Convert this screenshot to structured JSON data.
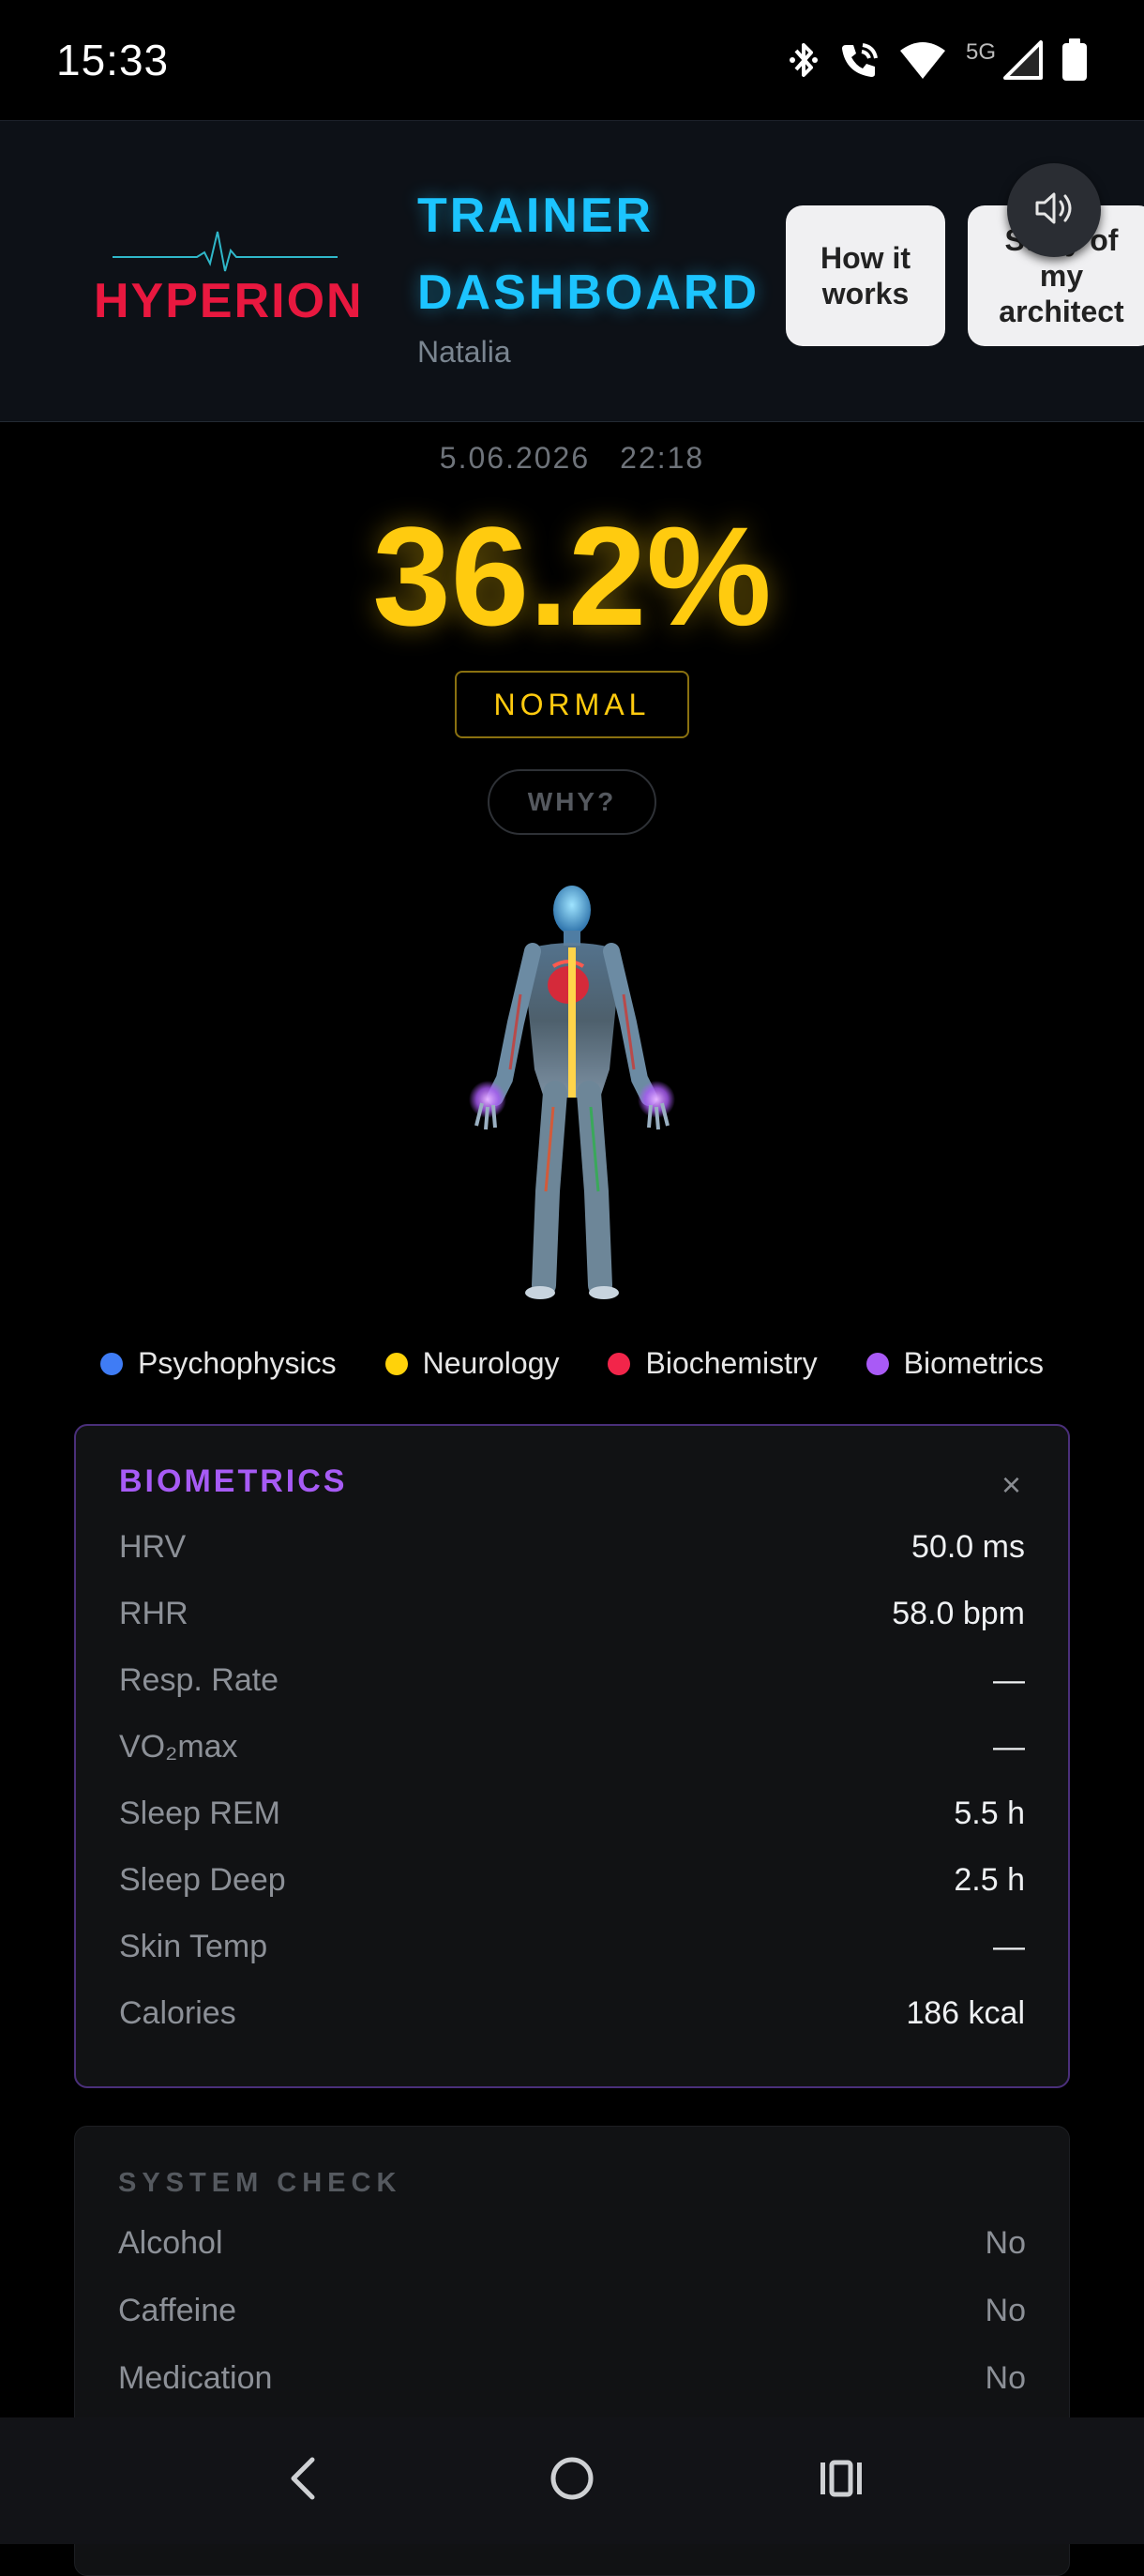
{
  "status_bar": {
    "time": "15:33",
    "network_label": "5G",
    "icons": [
      "bluetooth-icon",
      "wifi-calling-icon",
      "wifi-icon",
      "cell-signal-icon",
      "battery-icon"
    ]
  },
  "header": {
    "logo_text": "HYPERION",
    "title_line1": "TRAINER",
    "title_line2": "DASHBOARD",
    "user_name": "Natalia",
    "how_button": "How it works",
    "story_button": "Story of my architect",
    "sound_icon": "volume-icon"
  },
  "main": {
    "date": "5.06.2026",
    "time": "22:18",
    "score": "36.2%",
    "status": "NORMAL",
    "why_button": "WHY?"
  },
  "legend": [
    {
      "label": "Psychophysics",
      "color": "#3f7cf5"
    },
    {
      "label": "Neurology",
      "color": "#ffd20a"
    },
    {
      "label": "Biochemistry",
      "color": "#f2254a"
    },
    {
      "label": "Biometrics",
      "color": "#a95af6"
    }
  ],
  "biometrics": {
    "title": "BIOMETRICS",
    "close": "×",
    "rows": [
      {
        "label": "HRV",
        "value": "50.0 ms"
      },
      {
        "label": "RHR",
        "value": "58.0 bpm"
      },
      {
        "label": "Resp. Rate",
        "value": "—"
      },
      {
        "label": "VO₂max",
        "value": "—"
      },
      {
        "label": "Sleep REM",
        "value": "5.5 h"
      },
      {
        "label": "Sleep Deep",
        "value": "2.5 h"
      },
      {
        "label": "Skin Temp",
        "value": "—"
      },
      {
        "label": "Calories",
        "value": "186 kcal"
      }
    ]
  },
  "system_check": {
    "title": "SYSTEM CHECK",
    "rows": [
      {
        "label": "Alcohol",
        "value": "No"
      },
      {
        "label": "Caffeine",
        "value": "No"
      },
      {
        "label": "Medication",
        "value": "No"
      }
    ]
  },
  "colors": {
    "accent_yellow": "#ffcb0f",
    "title_cyan": "#1cc4ff",
    "brand_red": "#e8183f",
    "biometrics_purple": "#a75bf5"
  }
}
